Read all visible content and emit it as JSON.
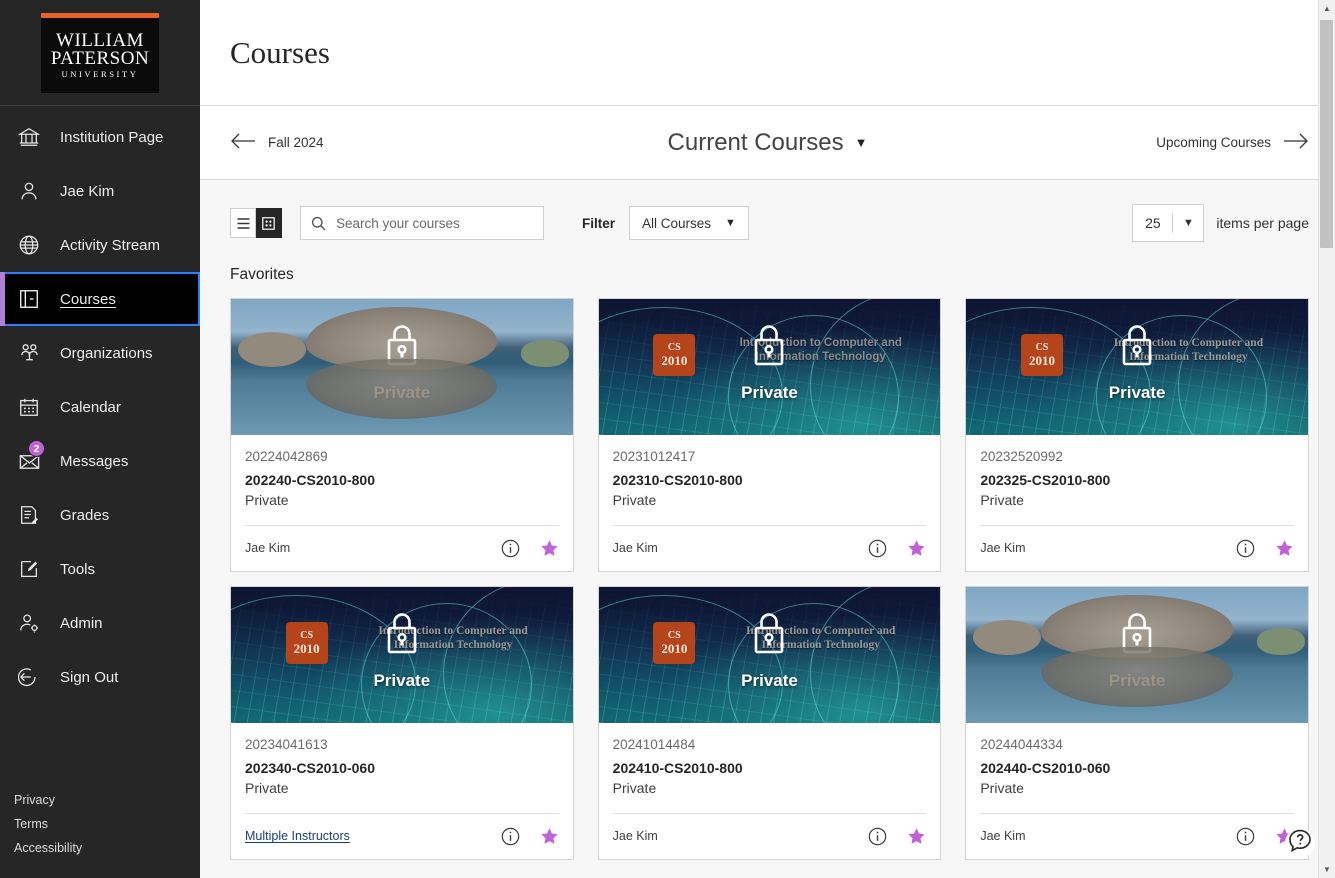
{
  "sidebar": {
    "logo": {
      "line1": "WILLIAM",
      "line2": "PATERSON",
      "line3": "UNIVERSITY",
      "bar_color": "#e8622a"
    },
    "items": [
      {
        "label": "Institution Page",
        "icon": "institution-icon",
        "active": false
      },
      {
        "label": "Jae Kim",
        "icon": "person-icon",
        "active": false
      },
      {
        "label": "Activity Stream",
        "icon": "globe-icon",
        "active": false
      },
      {
        "label": "Courses",
        "icon": "courses-icon",
        "active": true
      },
      {
        "label": "Organizations",
        "icon": "organizations-icon",
        "active": false
      },
      {
        "label": "Calendar",
        "icon": "calendar-icon",
        "active": false
      },
      {
        "label": "Messages",
        "icon": "messages-icon",
        "active": false,
        "badge": "2"
      },
      {
        "label": "Grades",
        "icon": "grades-icon",
        "active": false
      },
      {
        "label": "Tools",
        "icon": "tools-icon",
        "active": false
      },
      {
        "label": "Admin",
        "icon": "admin-icon",
        "active": false
      },
      {
        "label": "Sign Out",
        "icon": "sign-out-icon",
        "active": false
      }
    ],
    "footer_links": [
      "Privacy",
      "Terms",
      "Accessibility"
    ],
    "accent_color": "#b07fd8",
    "focus_color": "#2a7fff"
  },
  "header": {
    "title": "Courses"
  },
  "term_bar": {
    "prev_label": "Fall 2024",
    "current_label": "Current Courses",
    "next_label": "Upcoming Courses"
  },
  "toolbar": {
    "list_view_icon": "list-view-icon",
    "grid_view_icon": "grid-view-icon",
    "active_view": "grid",
    "search": {
      "placeholder": "Search your courses",
      "value": ""
    },
    "filter_label": "Filter",
    "filter_value": "All Courses",
    "items_per_page_value": "25",
    "items_per_page_label": "items per page"
  },
  "section": {
    "favorites_title": "Favorites"
  },
  "courses": [
    {
      "banner_type": "lake",
      "banner_badge": null,
      "banner_title": null,
      "lock_label": "Private",
      "id": "20224042869",
      "name": "202240-CS2010-800",
      "availability": "Private",
      "instructor": "Jae Kim",
      "instructor_is_link": false,
      "favorited": true
    },
    {
      "banner_type": "cs2010",
      "banner_badge": {
        "line1": "CS",
        "line2": "2010"
      },
      "banner_title": "Introduction to Computer and Information Technology",
      "banner_title_font": "sans",
      "lock_label": "Private",
      "id": "20231012417",
      "name": "202310-CS2010-800",
      "availability": "Private",
      "instructor": "Jae Kim",
      "instructor_is_link": false,
      "favorited": true
    },
    {
      "banner_type": "cs2010",
      "banner_badge": {
        "line1": "CS",
        "line2": "2010"
      },
      "banner_title": "Introduction to Computer and Information Technology",
      "banner_title_font": "serif",
      "lock_label": "Private",
      "id": "20232520992",
      "name": "202325-CS2010-800",
      "availability": "Private",
      "instructor": "Jae Kim",
      "instructor_is_link": false,
      "favorited": true
    },
    {
      "banner_type": "cs2010",
      "banner_badge": {
        "line1": "CS",
        "line2": "2010"
      },
      "banner_title": "Introduction to Computer and Information Technology",
      "banner_title_font": "serif",
      "lock_label": "Private",
      "id": "20234041613",
      "name": "202340-CS2010-060",
      "availability": "Private",
      "instructor": "Multiple Instructors",
      "instructor_is_link": true,
      "favorited": true
    },
    {
      "banner_type": "cs2010",
      "banner_badge": {
        "line1": "CS",
        "line2": "2010"
      },
      "banner_title": "Introduction to Computer and Information Technology",
      "banner_title_font": "serif",
      "lock_label": "Private",
      "id": "20241014484",
      "name": "202410-CS2010-800",
      "availability": "Private",
      "instructor": "Jae Kim",
      "instructor_is_link": false,
      "favorited": true
    },
    {
      "banner_type": "lake",
      "banner_badge": null,
      "banner_title": null,
      "lock_label": "Private",
      "id": "20244044334",
      "name": "202440-CS2010-060",
      "availability": "Private",
      "instructor": "Jae Kim",
      "instructor_is_link": false,
      "favorited": true
    }
  ],
  "help": {
    "icon": "help-question-icon"
  },
  "colors": {
    "sidebar_bg": "#262626",
    "favorite_star": "#c061d6",
    "badge": "#c061d6",
    "logo_orange": "#e8622a",
    "link": "#1c3f7a"
  }
}
